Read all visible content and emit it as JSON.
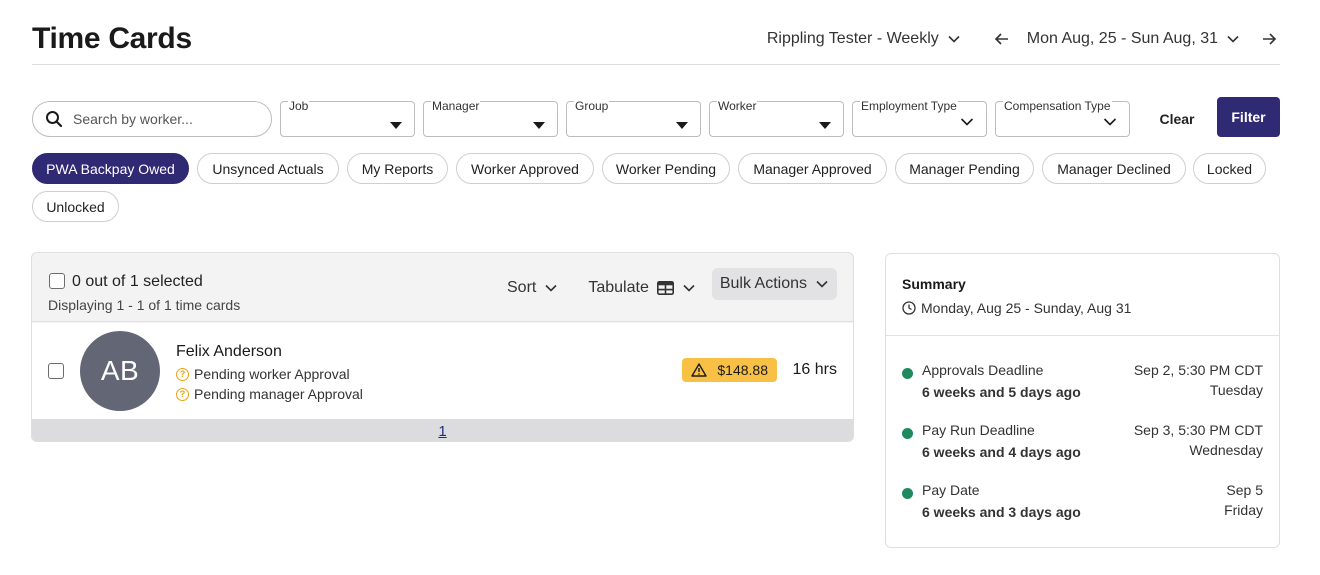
{
  "page_title": "Time Cards",
  "header": {
    "pay_schedule": "Rippling Tester - Weekly",
    "date_range": "Mon Aug, 25 - Sun Aug, 31"
  },
  "filters": {
    "search_placeholder": "Search by worker...",
    "dropdowns": [
      {
        "label": "Job",
        "caret": "filled"
      },
      {
        "label": "Manager",
        "caret": "filled"
      },
      {
        "label": "Group",
        "caret": "filled"
      },
      {
        "label": "Worker",
        "caret": "filled"
      },
      {
        "label": "Employment Type",
        "caret": "chevron"
      },
      {
        "label": "Compensation Type",
        "caret": "chevron"
      }
    ],
    "clear_label": "Clear",
    "filter_label": "Filter"
  },
  "chips": [
    {
      "label": "PWA Backpay Owed",
      "active": true
    },
    {
      "label": "Unsynced Actuals",
      "active": false
    },
    {
      "label": "My Reports",
      "active": false
    },
    {
      "label": "Worker Approved",
      "active": false
    },
    {
      "label": "Worker Pending",
      "active": false
    },
    {
      "label": "Manager Approved",
      "active": false
    },
    {
      "label": "Manager Pending",
      "active": false
    },
    {
      "label": "Manager Declined",
      "active": false
    },
    {
      "label": "Locked",
      "active": false
    },
    {
      "label": "Unlocked",
      "active": false
    }
  ],
  "timecards": {
    "selected_text": "0 out of 1 selected",
    "display_text": "Displaying 1 - 1 of 1 time cards",
    "sort_label": "Sort",
    "tabulate_label": "Tabulate",
    "bulk_actions_label": "Bulk Actions",
    "rows": [
      {
        "initials": "AB",
        "name": "Felix Anderson",
        "status_1": "Pending worker Approval",
        "status_2": "Pending manager Approval",
        "backpay": "$148.88",
        "hours": "16 hrs"
      }
    ],
    "page": "1"
  },
  "summary": {
    "title": "Summary",
    "range": "Monday, Aug 25 - Sunday, Aug 31",
    "deadlines": [
      {
        "name": "Approvals Deadline",
        "ago": "6 weeks and 5 days ago",
        "date": "Sep 2, 5:30 PM CDT",
        "day": "Tuesday"
      },
      {
        "name": "Pay Run Deadline",
        "ago": "6 weeks and 4 days ago",
        "date": "Sep 3, 5:30 PM CDT",
        "day": "Wednesday"
      },
      {
        "name": "Pay Date",
        "ago": "6 weeks and 3 days ago",
        "date": "Sep 5",
        "day": "Friday"
      }
    ]
  },
  "colors": {
    "primary": "#302973",
    "badge": "#f8c044",
    "status_dot": "#1f8a5e",
    "warning": "#e8a317"
  }
}
